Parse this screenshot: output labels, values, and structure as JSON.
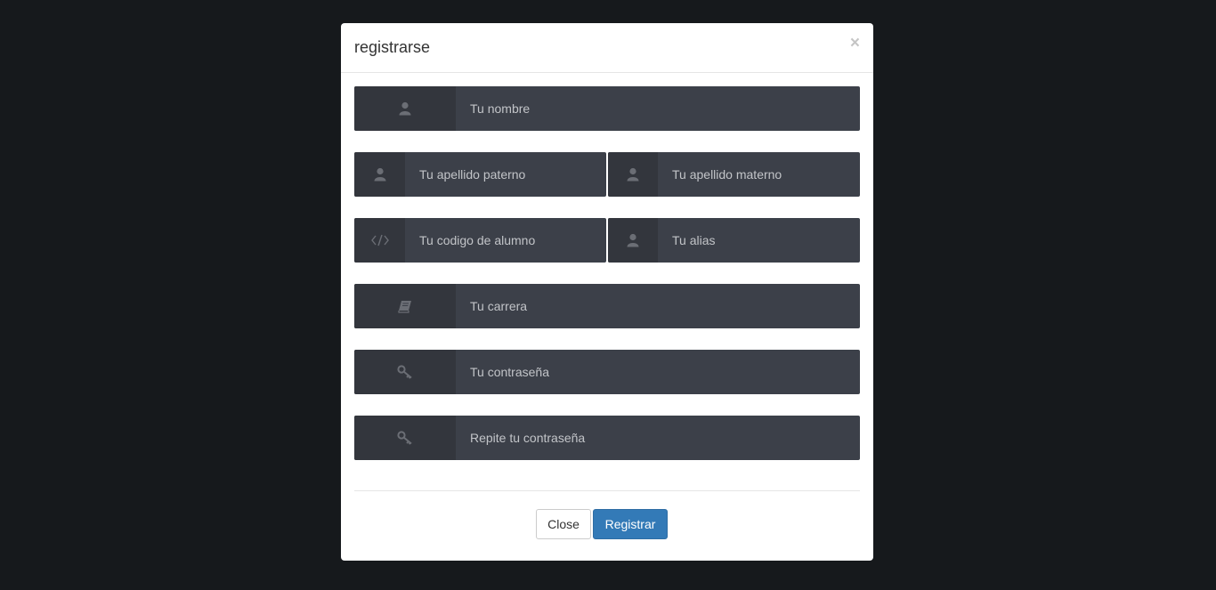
{
  "modal": {
    "title": "registrarse",
    "close_symbol": "×"
  },
  "form": {
    "nombre": {
      "placeholder": "Tu nombre",
      "icon": "user-icon"
    },
    "apellido_paterno": {
      "placeholder": "Tu apellido paterno",
      "icon": "user-icon"
    },
    "apellido_materno": {
      "placeholder": "Tu apellido materno",
      "icon": "user-icon"
    },
    "codigo_alumno": {
      "placeholder": "Tu codigo de alumno",
      "icon": "code-icon"
    },
    "alias": {
      "placeholder": "Tu alias",
      "icon": "user-icon"
    },
    "carrera": {
      "placeholder": "Tu carrera",
      "icon": "book-icon"
    },
    "contrasena": {
      "placeholder": "Tu contraseña",
      "icon": "key-icon"
    },
    "repite_contrasena": {
      "placeholder": "Repite tu contraseña",
      "icon": "key-icon"
    }
  },
  "footer": {
    "close_label": "Close",
    "submit_label": "Registrar"
  },
  "colors": {
    "backdrop": "#16191c",
    "field_bg": "#3c4049",
    "addon_bg": "#33363d",
    "icon": "#6b6e75",
    "primary": "#337ab7"
  }
}
